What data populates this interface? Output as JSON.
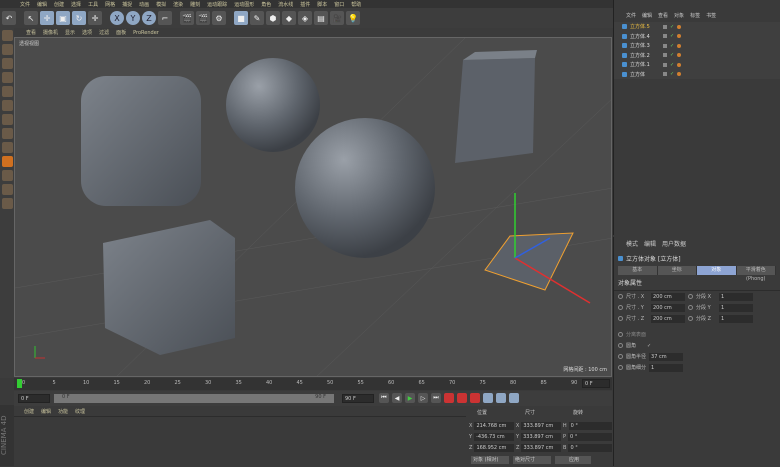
{
  "menu": [
    "文件",
    "编辑",
    "创建",
    "选择",
    "工具",
    "网格",
    "捕捉",
    "动画",
    "模拟",
    "渲染",
    "雕刻",
    "运动跟踪",
    "运动图形",
    "角色",
    "流水线",
    "插件",
    "脚本",
    "窗口",
    "帮助"
  ],
  "toolbar": [
    "undo-icon",
    "select-icon",
    "move-icon",
    "scale-icon",
    "rotate-icon",
    "move2-icon",
    "x-axis-icon",
    "y-axis-icon",
    "z-axis-icon",
    "coord-system-icon",
    "render-view-icon",
    "render-picture-icon",
    "render-settings-icon",
    "cube-icon",
    "pen-icon",
    "subdivision-icon",
    "array-icon",
    "deformer-icon",
    "floor-icon",
    "camera-icon",
    "light-icon"
  ],
  "toolbar_axes": [
    "X",
    "Y",
    "Z"
  ],
  "viewport": {
    "menu": [
      "查看",
      "摄像机",
      "显示",
      "选项",
      "过滤",
      "面板",
      "ProRender"
    ],
    "label": "透视视图",
    "grid": "网格间距 : 100 cm"
  },
  "timeline": {
    "ticks": [
      "0",
      "5",
      "10",
      "15",
      "20",
      "25",
      "30",
      "35",
      "40",
      "45",
      "50",
      "55",
      "60",
      "65",
      "70",
      "75",
      "80",
      "85",
      "90"
    ],
    "end": "0 F",
    "start_field": "0 F",
    "range_start": "0 F",
    "range_end": "90 F",
    "end_field": "90 F"
  },
  "material_menu": [
    "创建",
    "编辑",
    "功能",
    "纹理"
  ],
  "coords": {
    "headers": [
      "位置",
      "尺寸",
      "旋转"
    ],
    "rows": [
      {
        "axis": "X",
        "pos": "214.768 cm",
        "size_axis": "X",
        "size": "333.897 cm",
        "rot_axis": "H",
        "rot": "0 °"
      },
      {
        "axis": "Y",
        "pos": "-436.73 cm",
        "size_axis": "Y",
        "size": "333.897 cm",
        "rot_axis": "P",
        "rot": "0 °"
      },
      {
        "axis": "Z",
        "pos": "168.952 cm",
        "size_axis": "Z",
        "size": "333.897 cm",
        "rot_axis": "B",
        "rot": "0 °"
      }
    ],
    "mode": "对象 (相对)",
    "size_mode": "绝对尺寸",
    "apply": "应用"
  },
  "brand": "CINEMA 4D",
  "objects": {
    "menu": [
      "文件",
      "编辑",
      "查看",
      "对象",
      "标签",
      "书签"
    ],
    "items": [
      "立方体.5",
      "立方体.4",
      "立方体.3",
      "立方体.2",
      "立方体.1",
      "立方体"
    ]
  },
  "attributes": {
    "menu": [
      "模式",
      "编辑",
      "用户数据"
    ],
    "title": "立方体对象 [立方体]",
    "tabs": [
      "基本",
      "坐标",
      "对象",
      "平滑着色(Phong)"
    ],
    "section": "对象属性",
    "size": [
      {
        "label": "尺寸 . X",
        "value": "200 cm",
        "seg_label": "分段 X",
        "seg": "1"
      },
      {
        "label": "尺寸 . Y",
        "value": "200 cm",
        "seg_label": "分段 Y",
        "seg": "1"
      },
      {
        "label": "尺寸 . Z",
        "value": "200 cm",
        "seg_label": "分段 Z",
        "seg": "1"
      }
    ],
    "separate": "分离表面",
    "fillet": "圆角",
    "fillet_check": "✓",
    "fillet_radius_label": "圆角半径",
    "fillet_radius": "37 cm",
    "fillet_sub_label": "圆角细分",
    "fillet_sub": "1"
  }
}
